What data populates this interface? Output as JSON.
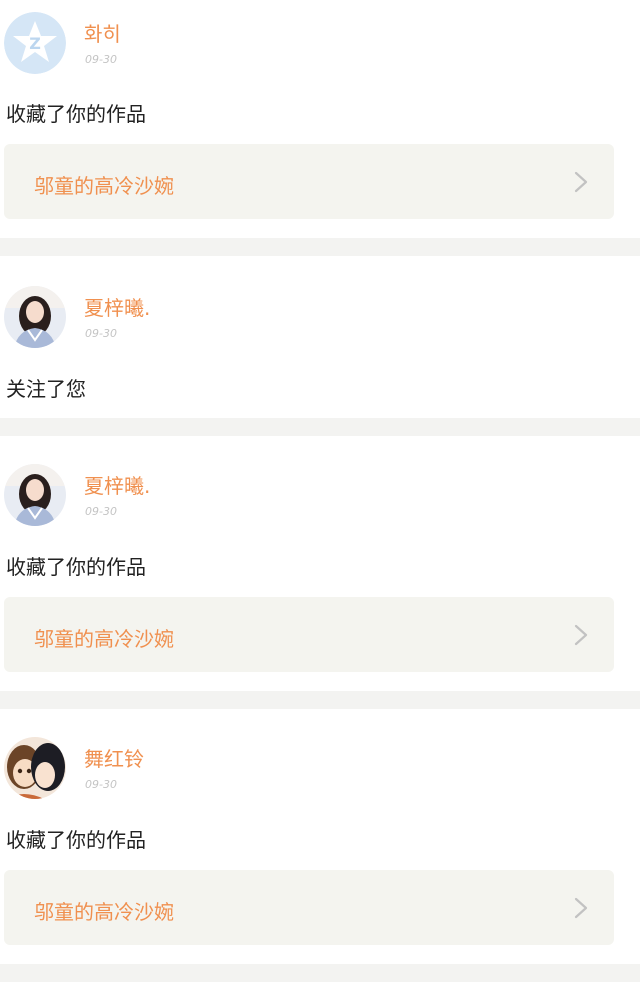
{
  "notifications": [
    {
      "user": "화히",
      "date": "09-30",
      "action": "收藏了你的作品",
      "work_title": "邬童的高冷沙婉",
      "avatar": "qq-avatar-icon"
    },
    {
      "user": "夏梓曦.",
      "date": "09-30",
      "action": "关注了您",
      "avatar": "girl-photo"
    },
    {
      "user": "夏梓曦.",
      "date": "09-30",
      "action": "收藏了你的作品",
      "work_title": "邬童的高冷沙婉",
      "avatar": "girl-photo"
    },
    {
      "user": "舞红铃",
      "date": "09-30",
      "action": "收藏了你的作品",
      "work_title": "邬童的高冷沙婉",
      "avatar": "anime-couple"
    }
  ],
  "colors": {
    "accent": "#f0904f",
    "card_bg": "#f4f4ef",
    "separator": "#f3f3f1",
    "text": "#222222",
    "date": "#c4c4c4"
  }
}
